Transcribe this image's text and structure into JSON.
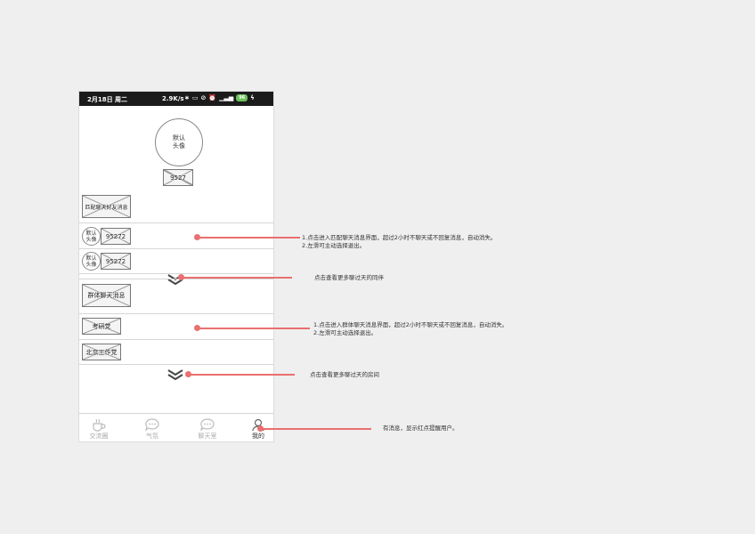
{
  "status_bar": {
    "date": "2月18日 周二",
    "speed": "2.9K/s",
    "battery": "96"
  },
  "profile": {
    "avatar_text": "默认\n头像",
    "username": "9527"
  },
  "match_section": {
    "title": "匹配聊天好友消息",
    "items": [
      {
        "avatar_text": "默认\n头像",
        "name": "95272"
      },
      {
        "avatar_text": "默认\n头像",
        "name": "95272"
      }
    ]
  },
  "group_section": {
    "title": "群体聊天消息",
    "items": [
      {
        "name": "考研党"
      },
      {
        "name": "北京工作党"
      }
    ]
  },
  "tabs": [
    {
      "label": "交流圈",
      "icon": "coffee-cup-icon"
    },
    {
      "label": "气氛",
      "icon": "chat-bubble-icon"
    },
    {
      "label": "聊天室",
      "icon": "chat-room-icon"
    },
    {
      "label": "我的",
      "icon": "person-icon"
    }
  ],
  "annotations": {
    "match_item": "1.点击进入匹配聊天消息界面，超过2小时不聊天或不回复消息，自动消失。\n2.左滑可主动选择退出。",
    "more_partners": "点击查看更多聊过天的同伴",
    "group_item": "1.点击进入群体聊天消息界面，超过2小时不聊天或不回复消息，自动消失。\n2.左滑可主动选择退出。",
    "more_rooms": "点击查看更多聊过天的房间",
    "my_tab": "有消息，显示红点提醒用户。"
  },
  "colors": {
    "annotation": "#ea6f6f",
    "status_bar": "#1b1b1b",
    "battery": "#6ac259"
  }
}
